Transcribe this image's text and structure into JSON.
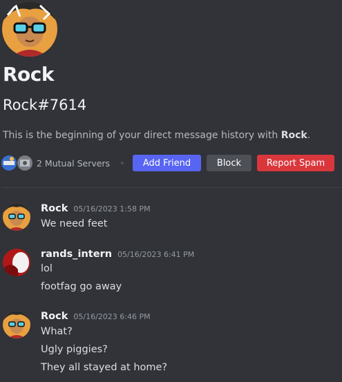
{
  "profile": {
    "display_name": "Rock",
    "tag": "Rock#7614",
    "intro_prefix": "This is the beginning of your direct message history with ",
    "intro_name": "Rock",
    "intro_suffix": ".",
    "avatar_icon": "cartoon-sunglasses-avatar"
  },
  "mutual": {
    "label": "2 Mutual Servers",
    "server_icons": [
      "server-icon-1",
      "server-icon-2"
    ]
  },
  "actions": {
    "add_friend": "Add Friend",
    "block": "Block",
    "report_spam": "Report Spam"
  },
  "colors": {
    "background": "#313338",
    "add_friend": "#5865f2",
    "block": "#4e5058",
    "report_spam": "#da373c"
  },
  "messages": [
    {
      "author": "Rock",
      "timestamp": "05/16/2023 1:58 PM",
      "avatar_icon": "cartoon-sunglasses-avatar",
      "lines": [
        "We need feet"
      ]
    },
    {
      "author": "rands_intern",
      "timestamp": "05/16/2023 6:41 PM",
      "avatar_icon": "red-white-avatar",
      "lines": [
        "lol",
        "footfag go away"
      ]
    },
    {
      "author": "Rock",
      "timestamp": "05/16/2023 6:46 PM",
      "avatar_icon": "cartoon-sunglasses-avatar",
      "lines": [
        "What?",
        "Ugly piggies?",
        "They all stayed at home?"
      ]
    }
  ]
}
